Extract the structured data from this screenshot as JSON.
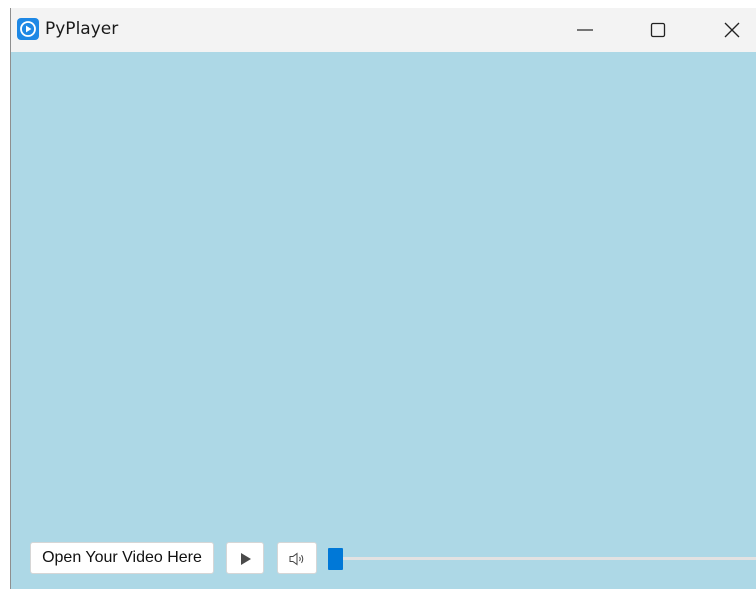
{
  "window": {
    "title": "PyPlayer",
    "background_color": "#add8e6",
    "accent_color": "#0078d7"
  },
  "titlebar": {
    "app_icon": "play-circle-icon",
    "minimize_icon": "minimize-icon",
    "maximize_icon": "maximize-icon",
    "close_icon": "close-icon"
  },
  "controls": {
    "open_label": "Open Your Video Here",
    "play_icon": "play-icon",
    "volume_icon": "volume-icon",
    "seek_position": 0
  }
}
